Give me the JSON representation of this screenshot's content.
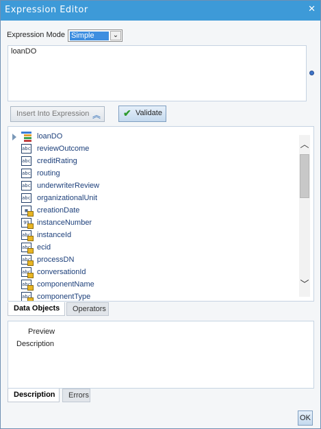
{
  "window": {
    "title": "Expression Editor",
    "close_glyph": "✕"
  },
  "mode": {
    "label": "Expression Mode",
    "selected": "Simple",
    "arrow": "⌄"
  },
  "expression": {
    "value": "loanDO"
  },
  "toolbar": {
    "insert_label": "Insert Into Expression",
    "insert_caret": "︽",
    "validate_label": "Validate",
    "validate_check": "✔"
  },
  "tree": {
    "items": [
      {
        "label": "loanDO",
        "icon": "data-object-icon"
      },
      {
        "label": "reviewOutcome",
        "icon": "string-icon"
      },
      {
        "label": "creditRating",
        "icon": "string-icon"
      },
      {
        "label": "routing",
        "icon": "string-icon"
      },
      {
        "label": "underwriterReview",
        "icon": "string-icon"
      },
      {
        "label": "organizationalUnit",
        "icon": "string-icon"
      },
      {
        "label": "creationDate",
        "icon": "date-locked-icon"
      },
      {
        "label": "instanceNumber",
        "icon": "number-locked-icon"
      },
      {
        "label": "instanceId",
        "icon": "string-locked-icon"
      },
      {
        "label": "ecid",
        "icon": "string-locked-icon"
      },
      {
        "label": "processDN",
        "icon": "string-locked-icon"
      },
      {
        "label": "conversationId",
        "icon": "string-locked-icon"
      },
      {
        "label": "componentName",
        "icon": "string-locked-icon"
      },
      {
        "label": "componentType",
        "icon": "string-locked-icon"
      }
    ],
    "scroll_up": "︿",
    "scroll_down": "﹀"
  },
  "tabs_top": [
    {
      "label": "Data Objects",
      "active": true
    },
    {
      "label": "Operators",
      "active": false
    }
  ],
  "description_panel": {
    "preview_label": "Preview",
    "description_label": "Description"
  },
  "tabs_bottom": [
    {
      "label": "Description",
      "active": true
    },
    {
      "label": "Errors",
      "active": false
    }
  ],
  "footer": {
    "ok_label": "OK"
  },
  "colors": {
    "titlebar": "#3d9ad8",
    "link_text": "#1c3f7a",
    "select_highlight": "#3d8ee0"
  }
}
